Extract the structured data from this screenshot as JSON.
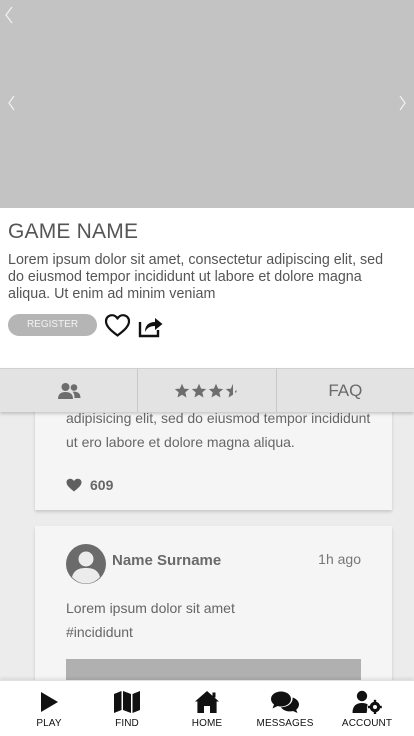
{
  "game": {
    "title": "GAME NAME",
    "description": "Lorem ipsum dolor sit amet, consectetur adipiscing elit, sed do eiusmod tempor incididunt ut labore et dolore magna aliqua. Ut enim ad minim veniam",
    "register_label": "REGISTER"
  },
  "tabs": [
    {
      "icon": "users-icon"
    },
    {
      "icon": "star-rating-icon",
      "rating": 3.5,
      "max": 4
    },
    {
      "label": "FAQ"
    }
  ],
  "posts": [
    {
      "text": "adipisicing elit, sed do eiusmod tempor incididunt ut ero labore et dolore magna aliqua.",
      "likes": "609"
    },
    {
      "author": "Name Surname",
      "time": "1h ago",
      "text_line1": "Lorem ipsum dolor sit amet",
      "text_line2": "#incididunt"
    }
  ],
  "nav": {
    "play": "PLAY",
    "find": "FIND",
    "home": "HOME",
    "messages": "MESSAGES",
    "account": "ACCOUNT"
  },
  "colors": {
    "hero_placeholder": "#c3c3c3",
    "tab_bar": "#e3e3e3",
    "feed_background": "#ececec",
    "card_background": "#f5f5f5",
    "register_button": "#b5b5b5"
  }
}
